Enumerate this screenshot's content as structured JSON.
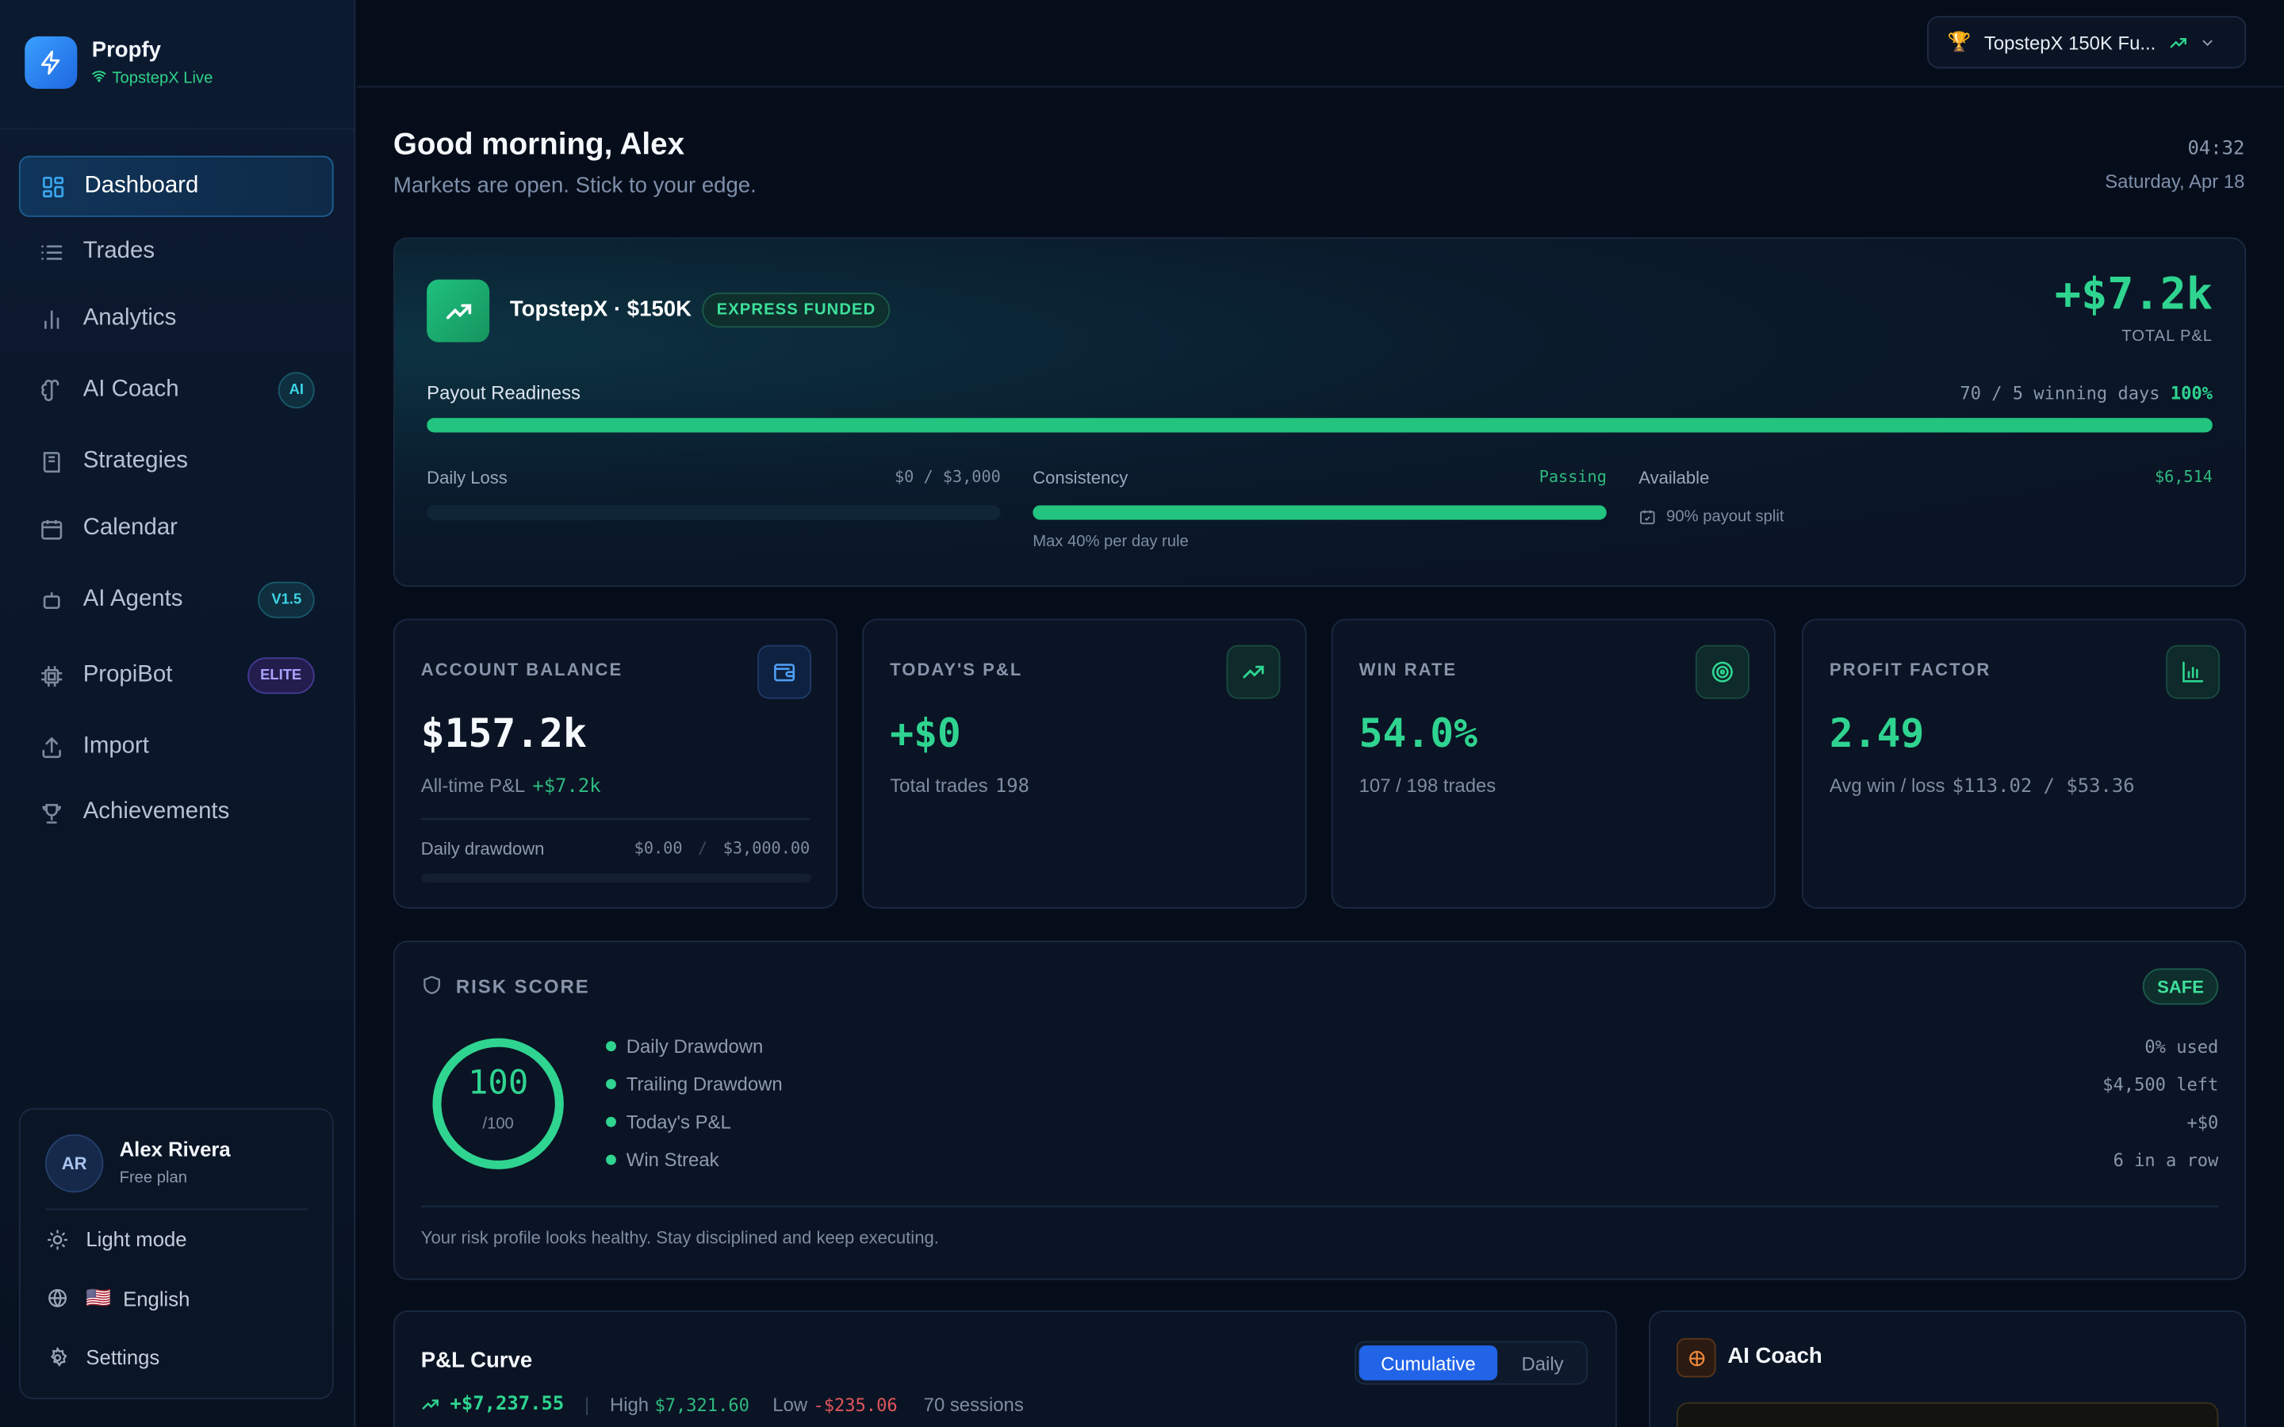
{
  "brand": {
    "name": "Propfy",
    "status": "TopstepX Live"
  },
  "nav": [
    {
      "label": "Dashboard",
      "icon": "dashboard-icon"
    },
    {
      "label": "Trades",
      "icon": "list-icon"
    },
    {
      "label": "Analytics",
      "icon": "bar-chart-icon"
    },
    {
      "label": "AI Coach",
      "icon": "brain-icon",
      "badge": "AI"
    },
    {
      "label": "Strategies",
      "icon": "book-icon"
    },
    {
      "label": "Calendar",
      "icon": "calendar-icon"
    },
    {
      "label": "AI Agents",
      "icon": "robot-icon",
      "badge": "V1.5"
    },
    {
      "label": "PropiBot",
      "icon": "chip-icon",
      "badge": "ELITE"
    },
    {
      "label": "Import",
      "icon": "upload-icon"
    },
    {
      "label": "Achievements",
      "icon": "trophy-icon"
    }
  ],
  "user": {
    "initials": "AR",
    "name": "Alex Rivera",
    "plan": "Free plan",
    "theme_label": "Light mode",
    "language_flag": "🇺🇸",
    "language": "English",
    "settings_label": "Settings"
  },
  "topbar": {
    "account": "TopstepX 150K Fu...",
    "account_emoji": "🏆"
  },
  "header": {
    "greeting": "Good morning, Alex",
    "subtitle": "Markets are open. Stick to your edge.",
    "time": "04:32",
    "date": "Saturday, Apr 18"
  },
  "hero": {
    "account_name": "TopstepX · $150K",
    "badge": "EXPRESS FUNDED",
    "total_pnl": "+$7.2k",
    "total_pnl_label": "TOTAL P&L",
    "payout_label": "Payout Readiness",
    "payout_days": "70 / 5 winning days",
    "payout_pct": "100%",
    "payout_fraction": 1.0,
    "daily_loss_label": "Daily Loss",
    "daily_loss_value": "$0 / $3,000",
    "daily_loss_fraction": 0,
    "consistency_label": "Consistency",
    "consistency_status": "Passing",
    "consistency_rule": "Max 40% per day rule",
    "consistency_fraction": 1.0,
    "available_label": "Available",
    "available_value": "$6,514",
    "payout_split": "90% payout split"
  },
  "stats": [
    {
      "title": "ACCOUNT BALANCE",
      "value": "$157.2k",
      "sub_label": "All-time P&L",
      "sub_value": "+$7.2k",
      "drawdown_label": "Daily drawdown",
      "drawdown_used": "$0.00",
      "drawdown_sep": "/",
      "drawdown_max": "$3,000.00",
      "drawdown_fraction": 0
    },
    {
      "title": "TODAY'S P&L",
      "value": "+$0",
      "sub_label": "Total trades",
      "sub_value": "198"
    },
    {
      "title": "WIN RATE",
      "value": "54.0%",
      "sub_label": "107 / 198 trades"
    },
    {
      "title": "PROFIT FACTOR",
      "value": "2.49",
      "sub_label": "Avg win / loss",
      "sub_value": "$113.02 / $53.36"
    }
  ],
  "risk": {
    "title": "RISK SCORE",
    "status": "SAFE",
    "score": "100",
    "score_max": "/100",
    "score_fraction": 1.0,
    "rows": [
      {
        "label": "Daily Drawdown",
        "value": "0% used"
      },
      {
        "label": "Trailing Drawdown",
        "value": "$4,500 left"
      },
      {
        "label": "Today's P&L",
        "value": "+$0"
      },
      {
        "label": "Win Streak",
        "value": "6 in a row"
      }
    ],
    "message": "Your risk profile looks healthy. Stay disciplined and keep executing."
  },
  "pl_curve": {
    "title": "P&L Curve",
    "tab_cumulative": "Cumulative",
    "tab_daily": "Daily",
    "total": "+$7,237.55",
    "sep": "|",
    "high_label": "High",
    "high_value": "$7,321.60",
    "low_label": "Low",
    "low_value": "-$235.06",
    "sessions": "70 sessions"
  },
  "ai_coach": {
    "title": "AI Coach"
  },
  "colors": {
    "green": "#2fd490",
    "accent_blue": "#2164e8",
    "background": "#060d1a",
    "card": "#0a1424"
  }
}
